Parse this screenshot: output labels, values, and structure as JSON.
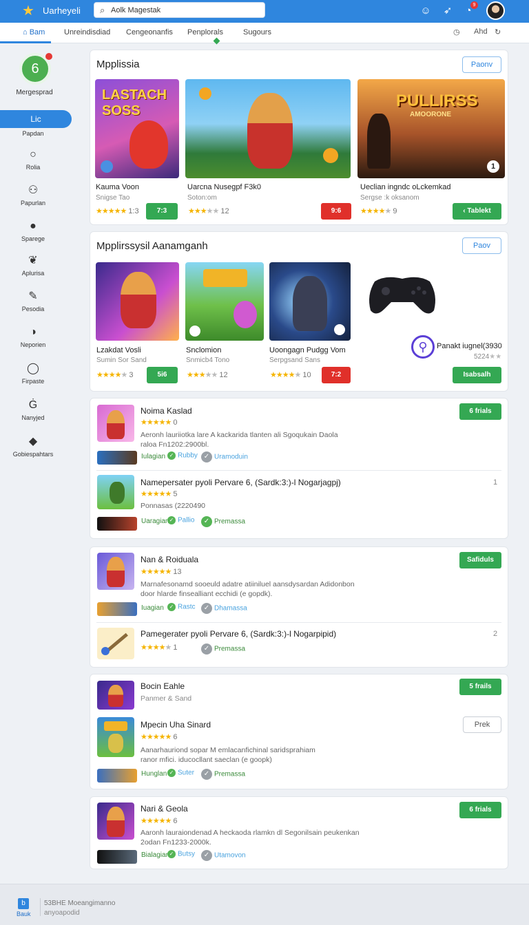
{
  "header": {
    "app_title": "Uarheyeli",
    "search_value": "Aolk Magestak",
    "notification_count": "9"
  },
  "nav": {
    "tabs": [
      "Bam",
      "Unreindisdiad",
      "Cengeonanfis",
      "Penplorals",
      "Sugours"
    ],
    "right_label": "Ahd"
  },
  "sidebar": {
    "brand": "Mergesprad",
    "active": {
      "label": "Lic",
      "sublabel": "Papdan"
    },
    "items": [
      {
        "label": "Rolia",
        "icon": "circle-icon"
      },
      {
        "label": "Papurlan",
        "icon": "group-icon"
      },
      {
        "label": "Sparege",
        "icon": "user-icon"
      },
      {
        "label": "Aplurisa",
        "icon": "leaf-icon"
      },
      {
        "label": "Pesodia",
        "icon": "edit-icon"
      },
      {
        "label": "Neporien",
        "icon": "info-icon"
      },
      {
        "label": "Firpaste",
        "icon": "ring-icon"
      },
      {
        "label": "Nanyjed",
        "icon": "g-icon"
      },
      {
        "label": "Gobiespahtars",
        "icon": "chat-icon"
      }
    ]
  },
  "section1": {
    "title": "Mpplissia",
    "button": "Paonv",
    "games": [
      {
        "name": "Kauma Voon",
        "sub": "Snigse Tao",
        "count": "1:3",
        "rating": 4,
        "btn": "7:3",
        "btn_color": "green",
        "art_title": "LASTACH SOSS"
      },
      {
        "name": "Uarcna Nusegpf F3k0",
        "sub": "Soton:om",
        "count": "12",
        "rating": 3,
        "btn": "9:6",
        "btn_color": "red"
      },
      {
        "name": "Ueclian ingndc oLckemkad",
        "sub": "Sergse :k oksanom",
        "count": "9",
        "rating": 4.5,
        "btn": "Tablekt",
        "btn_color": "green",
        "art_title": "PULLIRSS",
        "art_sub": "AMOORONE",
        "badge": "1"
      }
    ]
  },
  "section2": {
    "title": "Mpplirssysil Aanamganh",
    "button": "Paov",
    "games": [
      {
        "name": "Lzakdat Vosli",
        "sub": "Sumin Sor Sand",
        "count": "3",
        "rating": 4,
        "btn": "5i6",
        "btn_color": "green"
      },
      {
        "name": "Snclomion",
        "sub": "Snmicb4 Tono",
        "count": "12",
        "rating": 3,
        "btn": "",
        "btn_color": ""
      },
      {
        "name": "Uoongagn Pudgg Vom",
        "sub": "Serpgsand Sans",
        "count": "10",
        "rating": 4,
        "btn": "7:2",
        "btn_color": "red"
      }
    ],
    "promo": {
      "name": "Panakt iugnel(3930",
      "sub": "5224",
      "btn": "Isabsalh"
    }
  },
  "list1": {
    "btn": "6 frials",
    "items": [
      {
        "name": "Noima Kaslad",
        "count": "0",
        "desc_line1": "Aeronh lauriiotka lare A kackarida tlanten ali Sgoqukain Daola",
        "desc_line2": "raloa Fn1202:2900bl.",
        "tag1": "Iulagian",
        "tag2": "Rubby",
        "tag3": "Uramoduin"
      },
      {
        "name": "Namepersater pyoli Pervare 6, (Sardk:3:)-l Nogarjagpj)",
        "count": "5",
        "desc_line1": "Ponnasas (2220490",
        "tag1": "Uaragian",
        "tag2": "Pallio",
        "tag3": "Premassa",
        "index": "1"
      }
    ]
  },
  "list2": {
    "btn": "Safiduls",
    "items": [
      {
        "name": "Nan & Roiduala",
        "count": "13",
        "desc_line1": "Marnafesonamd sooeuld adatre atiiniluel aansdysardan Adidonbon",
        "desc_line2": "door hlarde finsealliant ecchidi (e gopdk).",
        "tag1": "Iuagian",
        "tag2": "Rastc",
        "tag3": "Dhamassa"
      },
      {
        "name": "Pamegerater pyoli Pervare 6, (Sardk:3:)-l Nogarpipid)",
        "count": "1",
        "tag3": "Premassa",
        "index": "2"
      }
    ]
  },
  "list3": {
    "btn": "5 frails",
    "items": [
      {
        "name": "Bocin Eahle",
        "sub": "Panmer & Sand"
      },
      {
        "name": "Mpecin Uha Sinard",
        "count": "6",
        "desc_line1": "Aanarhauriond sopar M emlacanfichinal saridsprahiam",
        "desc_line2": "ranor mfici. iducocllant saeclan (e goopk)",
        "tag1": "Hunglan",
        "tag2": "Suter",
        "tag3": "Premassa",
        "btn": "Prek"
      }
    ]
  },
  "list4": {
    "btn": "6 frials",
    "items": [
      {
        "name": "Nari & Geola",
        "count": "6",
        "desc_line1": "Aaronh lauraiondenad A heckaoda rlamkn dl Segonilsain peukenkan",
        "desc_line2": "2odan Fn1233-2000k.",
        "tag1": "Bialagian",
        "tag2": "Butsy",
        "tag3": "Utamovon"
      }
    ]
  },
  "footer": {
    "brand": "Bauk",
    "line1": "53BHE Moeangimanno",
    "line2": "anyoapodid"
  },
  "colors": {
    "primary": "#2f86de",
    "green": "#34a853",
    "red": "#e0302a",
    "star": "#f5b400"
  }
}
